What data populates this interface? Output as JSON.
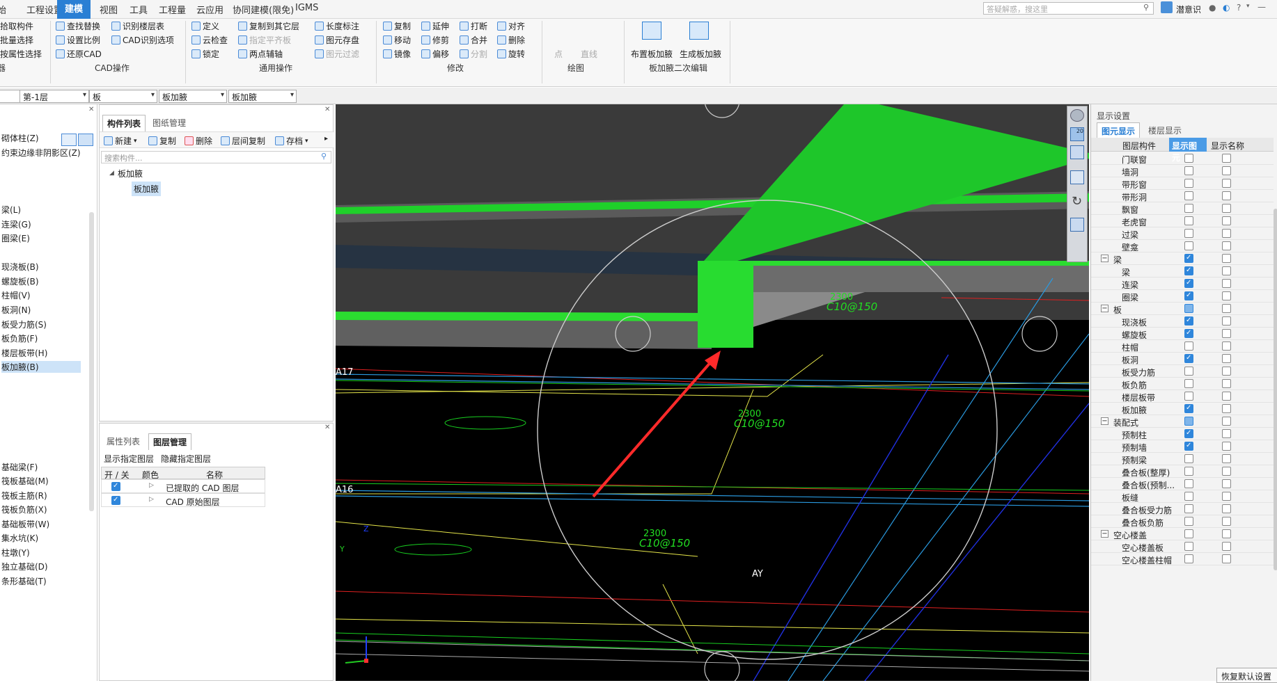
{
  "menubar": {
    "items": [
      "始",
      "工程设置",
      "建模",
      "视图",
      "工具",
      "工程量",
      "云应用",
      "协同建模(限免)",
      "IGMS"
    ],
    "active_index": 2,
    "search_placeholder": "答疑解惑，搜这里",
    "user": "潜意识",
    "help": "?"
  },
  "ribbon": {
    "col1": [
      "拾取构件",
      "批量选择",
      "按属性选择"
    ],
    "col1_group": "器",
    "cad": [
      "查找替换",
      "设置比例",
      "还原CAD",
      "识别楼层表",
      "CAD识别选项"
    ],
    "cad_group": "CAD操作",
    "general": [
      "定义",
      "云检查",
      "锁定",
      "复制到其它层",
      "指定平齐板",
      "两点辅轴",
      "长度标注",
      "图元存盘",
      "图元过滤"
    ],
    "general_group": "通用操作",
    "modify": [
      "复制",
      "移动",
      "镜像",
      "延伸",
      "修剪",
      "偏移",
      "打断",
      "合并",
      "分割",
      "对齐",
      "删除",
      "旋转"
    ],
    "modify_group": "修改",
    "draw": [
      "点",
      "直线"
    ],
    "draw_group": "绘图",
    "edit2": [
      "布置板加腋",
      "生成板加腋"
    ],
    "edit2_group": "板加腋二次编辑"
  },
  "selectors": [
    "第-1层",
    "板",
    "板加腋",
    "板加腋"
  ],
  "left_panel": {
    "items": [
      "砌体柱(Z)",
      "约束边缘非阴影区(Z)",
      "梁(L)",
      "连梁(G)",
      "圈梁(E)",
      "现浇板(B)",
      "螺旋板(B)",
      "柱帽(V)",
      "板洞(N)",
      "板受力筋(S)",
      "板负筋(F)",
      "楼层板带(H)",
      "板加腋(B)",
      "基础梁(F)",
      "筏板基础(M)",
      "筏板主筋(R)",
      "筏板负筋(X)",
      "基础板带(W)",
      "集水坑(K)",
      "柱墩(Y)",
      "独立基础(D)",
      "条形基础(T)"
    ],
    "selected": "板加腋(B)"
  },
  "component_panel": {
    "tabs": [
      "构件列表",
      "图纸管理"
    ],
    "toolbar": [
      "新建",
      "复制",
      "删除",
      "层间复制",
      "存档"
    ],
    "search_placeholder": "搜索构件...",
    "tree_root": "板加腋",
    "tree_child": "板加腋"
  },
  "layer_panel": {
    "tabs": [
      "属性列表",
      "图层管理"
    ],
    "actions": [
      "显示指定图层",
      "隐藏指定图层"
    ],
    "headers": [
      "开 / 关",
      "颜色",
      "名称"
    ],
    "rows": [
      "已提取的 CAD 图层",
      "CAD 原始图层"
    ]
  },
  "viewport": {
    "labels": [
      "A17",
      "A16",
      "AY"
    ],
    "cad_texts": [
      "C10@150",
      "C10@150",
      "C10@150"
    ],
    "dim_texts": [
      "2300",
      "2300",
      "2300"
    ],
    "axis_z": "Z",
    "axis_y": "Y",
    "zoom_label": "20"
  },
  "display_settings": {
    "title": "显示设置",
    "tabs": [
      "图元显示",
      "楼层显示"
    ],
    "headers": [
      "图层构件",
      "显示图元",
      "显示名称"
    ],
    "rows": [
      {
        "name": "门联窗",
        "level": 2,
        "show": false,
        "name_show": false
      },
      {
        "name": "墙洞",
        "level": 2,
        "show": false,
        "name_show": false
      },
      {
        "name": "带形窗",
        "level": 2,
        "show": false,
        "name_show": false
      },
      {
        "name": "带形洞",
        "level": 2,
        "show": false,
        "name_show": false
      },
      {
        "name": "飘窗",
        "level": 2,
        "show": false,
        "name_show": false
      },
      {
        "name": "老虎窗",
        "level": 2,
        "show": false,
        "name_show": false
      },
      {
        "name": "过梁",
        "level": 2,
        "show": false,
        "name_show": false
      },
      {
        "name": "壁龛",
        "level": 2,
        "show": false,
        "name_show": false
      },
      {
        "name": "梁",
        "level": 1,
        "show": true,
        "name_show": false
      },
      {
        "name": "梁",
        "level": 2,
        "show": true,
        "name_show": false
      },
      {
        "name": "连梁",
        "level": 2,
        "show": true,
        "name_show": false
      },
      {
        "name": "圈梁",
        "level": 2,
        "show": true,
        "name_show": false
      },
      {
        "name": "板",
        "level": 1,
        "show": "partial",
        "name_show": false
      },
      {
        "name": "现浇板",
        "level": 2,
        "show": true,
        "name_show": false
      },
      {
        "name": "螺旋板",
        "level": 2,
        "show": true,
        "name_show": false
      },
      {
        "name": "柱帽",
        "level": 2,
        "show": false,
        "name_show": false
      },
      {
        "name": "板洞",
        "level": 2,
        "show": true,
        "name_show": false
      },
      {
        "name": "板受力筋",
        "level": 2,
        "show": false,
        "name_show": false
      },
      {
        "name": "板负筋",
        "level": 2,
        "show": false,
        "name_show": false
      },
      {
        "name": "楼层板带",
        "level": 2,
        "show": false,
        "name_show": false
      },
      {
        "name": "板加腋",
        "level": 2,
        "show": true,
        "name_show": false
      },
      {
        "name": "装配式",
        "level": 1,
        "show": "partial",
        "name_show": false
      },
      {
        "name": "预制柱",
        "level": 2,
        "show": true,
        "name_show": false
      },
      {
        "name": "预制墙",
        "level": 2,
        "show": true,
        "name_show": false
      },
      {
        "name": "预制梁",
        "level": 2,
        "show": false,
        "name_show": false
      },
      {
        "name": "叠合板(整厚)",
        "level": 2,
        "show": false,
        "name_show": false
      },
      {
        "name": "叠合板(预制...",
        "level": 2,
        "show": false,
        "name_show": false
      },
      {
        "name": "板缝",
        "level": 2,
        "show": false,
        "name_show": false
      },
      {
        "name": "叠合板受力筋",
        "level": 2,
        "show": false,
        "name_show": false
      },
      {
        "name": "叠合板负筋",
        "level": 2,
        "show": false,
        "name_show": false
      },
      {
        "name": "空心楼盖",
        "level": 1,
        "show": false,
        "name_show": false
      },
      {
        "name": "空心楼盖板",
        "level": 2,
        "show": false,
        "name_show": false
      },
      {
        "name": "空心楼盖柱帽",
        "level": 2,
        "show": false,
        "name_show": false
      }
    ],
    "restore_button": "恢复默认设置"
  }
}
